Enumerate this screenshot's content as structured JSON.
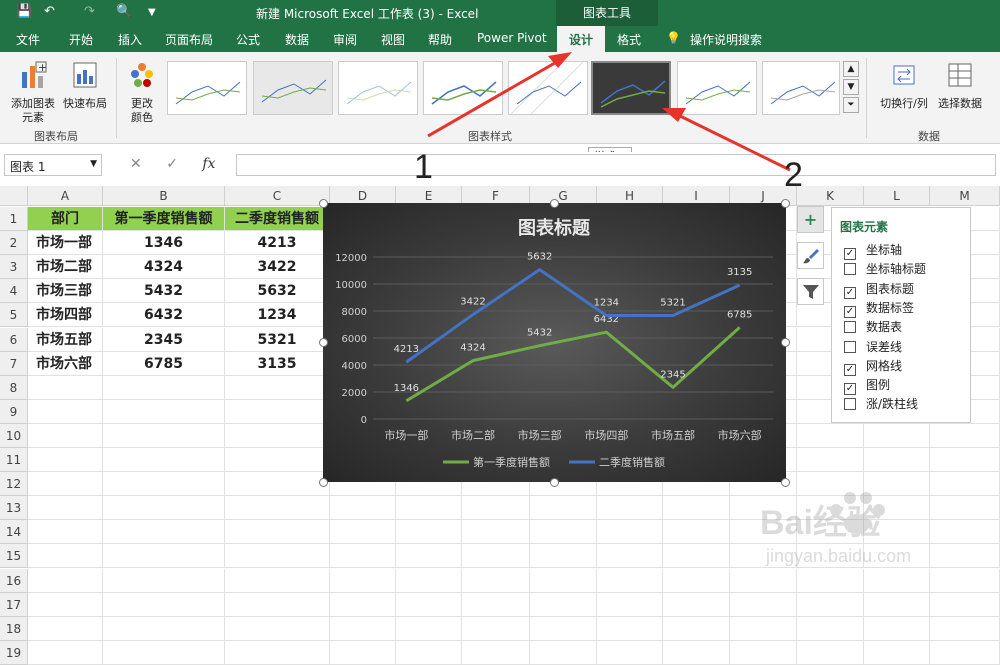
{
  "window": {
    "title": "新建 Microsoft Excel 工作表 (3)  -  Excel",
    "chart_tools": "图表工具"
  },
  "ribbon_tabs": [
    "文件",
    "开始",
    "插入",
    "页面布局",
    "公式",
    "数据",
    "审阅",
    "视图",
    "帮助",
    "Power Pivot",
    "设计",
    "格式",
    "操作说明搜索"
  ],
  "ribbon": {
    "add_element": "添加图表\n元素",
    "quick_layout": "快速布局",
    "change_color": "更改\n颜色",
    "group_layout": "图表布局",
    "group_styles": "图表样式",
    "switch_rowcol": "切换行/列",
    "select_data": "选择数据",
    "group_data": "数据",
    "tooltip": "样式 6"
  },
  "formula_bar": {
    "name_box": "图表 1",
    "fx": "fx"
  },
  "columns": [
    "A",
    "B",
    "C",
    "D",
    "E",
    "F",
    "G",
    "H",
    "I",
    "J",
    "K",
    "L",
    "M"
  ],
  "rows": [
    "1",
    "2",
    "3",
    "4",
    "5",
    "6",
    "7",
    "8",
    "9",
    "10",
    "11",
    "12",
    "13",
    "14",
    "15",
    "16",
    "17",
    "18",
    "19"
  ],
  "table": {
    "headers": [
      "部门",
      "第一季度销售额",
      "二季度销售额"
    ],
    "rows": [
      [
        "市场一部",
        "1346",
        "4213"
      ],
      [
        "市场二部",
        "4324",
        "3422"
      ],
      [
        "市场三部",
        "5432",
        "5632"
      ],
      [
        "市场四部",
        "6432",
        "1234"
      ],
      [
        "市场五部",
        "2345",
        "5321"
      ],
      [
        "市场六部",
        "6785",
        "3135"
      ]
    ]
  },
  "chart_data": {
    "type": "line",
    "title": "图表标题",
    "categories": [
      "市场一部",
      "市场二部",
      "市场三部",
      "市场四部",
      "市场五部",
      "市场六部"
    ],
    "series": [
      {
        "name": "第一季度销售额",
        "color": "#70ad47",
        "values": [
          1346,
          4324,
          5432,
          6432,
          2345,
          6785
        ]
      },
      {
        "name": "二季度销售额",
        "color": "#4472c4",
        "values": [
          4213,
          7735,
          11064,
          7666,
          7666,
          9920
        ],
        "labels": [
          "4213",
          "3422",
          "5632",
          "1234",
          "5321",
          "3135"
        ]
      }
    ],
    "yticks": [
      "0",
      "2000",
      "4000",
      "6000",
      "8000",
      "10000",
      "12000"
    ],
    "ylim": [
      0,
      12000
    ],
    "grid": true,
    "legend": "bottom",
    "background": "#3b3b3b"
  },
  "chart_elements": {
    "title": "图表元素",
    "items": [
      {
        "label": "坐标轴",
        "checked": true
      },
      {
        "label": "坐标轴标题",
        "checked": false
      },
      {
        "label": "图表标题",
        "checked": true
      },
      {
        "label": "数据标签",
        "checked": true
      },
      {
        "label": "数据表",
        "checked": false
      },
      {
        "label": "误差线",
        "checked": false
      },
      {
        "label": "网格线",
        "checked": true
      },
      {
        "label": "图例",
        "checked": true
      },
      {
        "label": "涨/跌柱线",
        "checked": false
      }
    ]
  },
  "annotations": {
    "arrow1": "1",
    "arrow2": "2"
  },
  "watermark": {
    "brand": "Bai经验",
    "url": "jingyan.baidu.com"
  }
}
